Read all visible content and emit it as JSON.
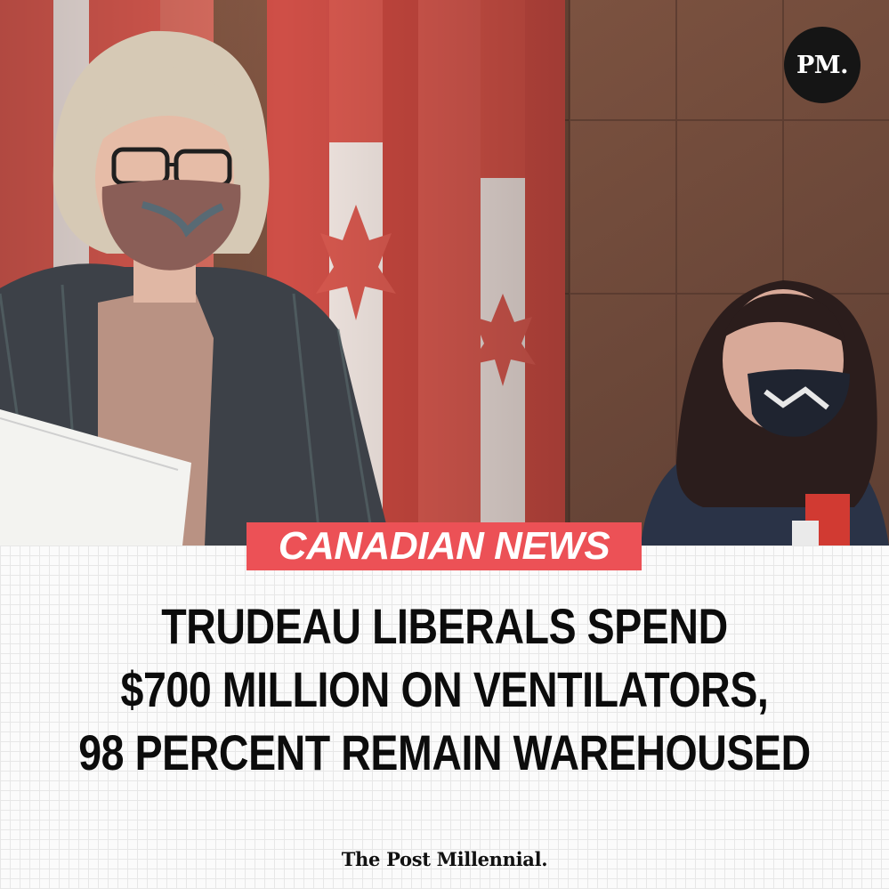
{
  "brand": {
    "badge_text": "PM.",
    "wordmark": "The Post Millennial."
  },
  "category": {
    "label": "CANADIAN NEWS",
    "color": "#ec5156"
  },
  "headline": {
    "lines": [
      "TRUDEAU LIBERALS SPEND",
      "$700 MILLION ON VENTILATORS,",
      "98 PERCENT REMAIN WAREHOUSED"
    ]
  },
  "colors": {
    "flag_red": "#d8594f",
    "wood_panel": "#6b4a3a",
    "badge_bg": "#151515",
    "headline_text": "#0c0c0c"
  }
}
